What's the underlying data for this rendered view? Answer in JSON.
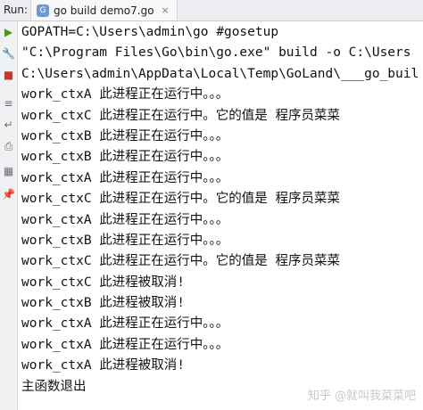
{
  "panel": {
    "run_label": "Run:"
  },
  "tab": {
    "label": "go build demo7.go",
    "icon_glyph": "G",
    "close_glyph": "×"
  },
  "toolbar": [
    {
      "name": "run-play-icon",
      "glyph": "▶"
    },
    {
      "name": "wrench-icon",
      "glyph": "🔧"
    },
    {
      "name": "stop-icon",
      "glyph": "■"
    },
    {
      "name": "restore-layout-icon",
      "glyph": "≡"
    },
    {
      "name": "soft-wrap-icon",
      "glyph": "↵"
    },
    {
      "name": "print-icon",
      "glyph": "⎙"
    },
    {
      "name": "layout-icon",
      "glyph": "▦"
    },
    {
      "name": "pin-icon",
      "glyph": "📌"
    }
  ],
  "console_lines": [
    "GOPATH=C:\\Users\\admin\\go #gosetup",
    "\"C:\\Program Files\\Go\\bin\\go.exe\" build -o C:\\Users",
    "C:\\Users\\admin\\AppData\\Local\\Temp\\GoLand\\___go_buil",
    "work_ctxA 此进程正在运行中。。。",
    "work_ctxC 此进程正在运行中。它的值是 程序员菜菜",
    "work_ctxB 此进程正在运行中。。。",
    "work_ctxB 此进程正在运行中。。。",
    "work_ctxA 此进程正在运行中。。。",
    "work_ctxC 此进程正在运行中。它的值是 程序员菜菜",
    "work_ctxA 此进程正在运行中。。。",
    "work_ctxB 此进程正在运行中。。。",
    "work_ctxC 此进程正在运行中。它的值是 程序员菜菜",
    "work_ctxC 此进程被取消!",
    "work_ctxB 此进程被取消!",
    "work_ctxA 此进程正在运行中。。。",
    "work_ctxA 此进程正在运行中。。。",
    "work_ctxA 此进程被取消!",
    "主函数退出"
  ],
  "watermark": "知乎 @就叫我菜菜吧"
}
